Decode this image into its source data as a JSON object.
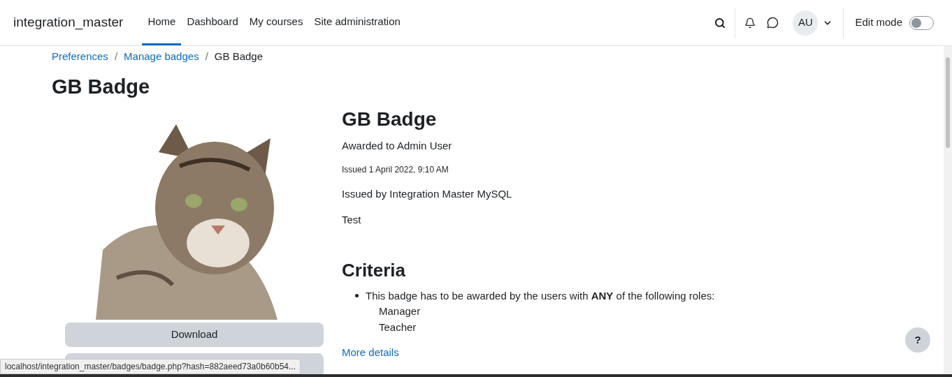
{
  "navbar": {
    "site_name": "integration_master",
    "links": [
      {
        "label": "Home",
        "selected": true
      },
      {
        "label": "Dashboard",
        "selected": false
      },
      {
        "label": "My courses",
        "selected": false
      },
      {
        "label": "Site administration",
        "selected": false
      }
    ],
    "avatar": "AU",
    "edit_mode": {
      "label": "Edit mode",
      "on": false
    }
  },
  "breadcrumb_separator": "/",
  "breadcrumb": [
    {
      "label": "Preferences",
      "link": true
    },
    {
      "label": "Manage badges",
      "link": true
    },
    {
      "label": "GB Badge",
      "link": false
    }
  ],
  "page_title": "GB Badge",
  "badge": {
    "download_button": "Download",
    "name": "GB Badge",
    "awarded_to": "Awarded to Admin User",
    "issued": "Issued 1 April 2022, 9:10 AM",
    "issued_by": "Issued by Integration Master MySQL",
    "description": "Test"
  },
  "criteria": {
    "title": "Criteria",
    "items": [
      {
        "text": "This badge has to be awarded by the users with **ANY** of the following roles:",
        "roles": [
          "Manager",
          "Teacher"
        ]
      }
    ],
    "more_link": "More details"
  },
  "help_button": "?",
  "status_bar": "localhost/integration_master/badges/badge.php?hash=882aeed73a0b60b54..."
}
